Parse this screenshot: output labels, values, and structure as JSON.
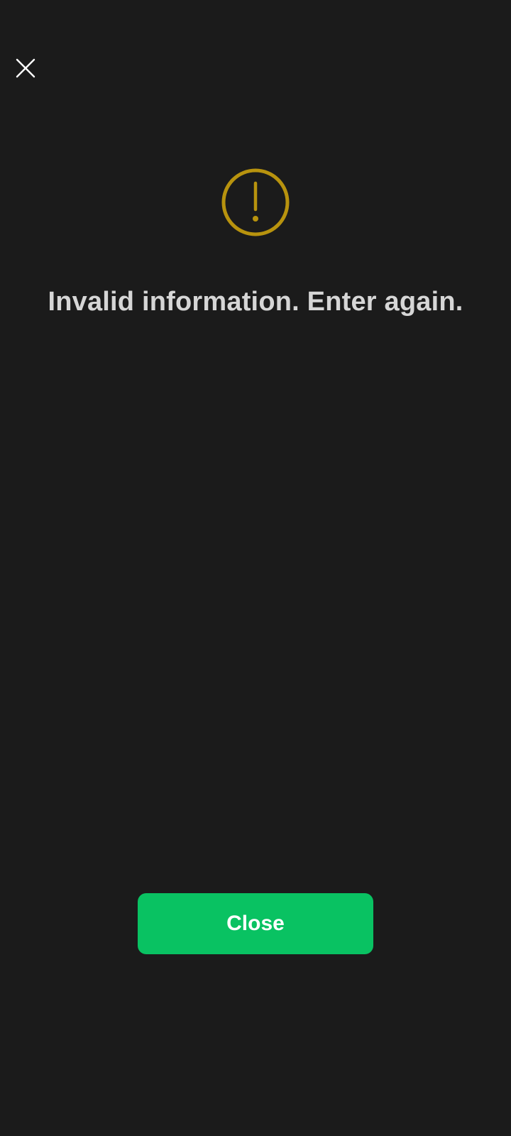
{
  "header": {
    "close_icon": "close-icon"
  },
  "alert": {
    "icon": "exclamation-circle-icon",
    "icon_color": "#B8930E",
    "message": "Invalid information. Enter again."
  },
  "footer": {
    "close_label": "Close",
    "button_color": "#09C262"
  }
}
